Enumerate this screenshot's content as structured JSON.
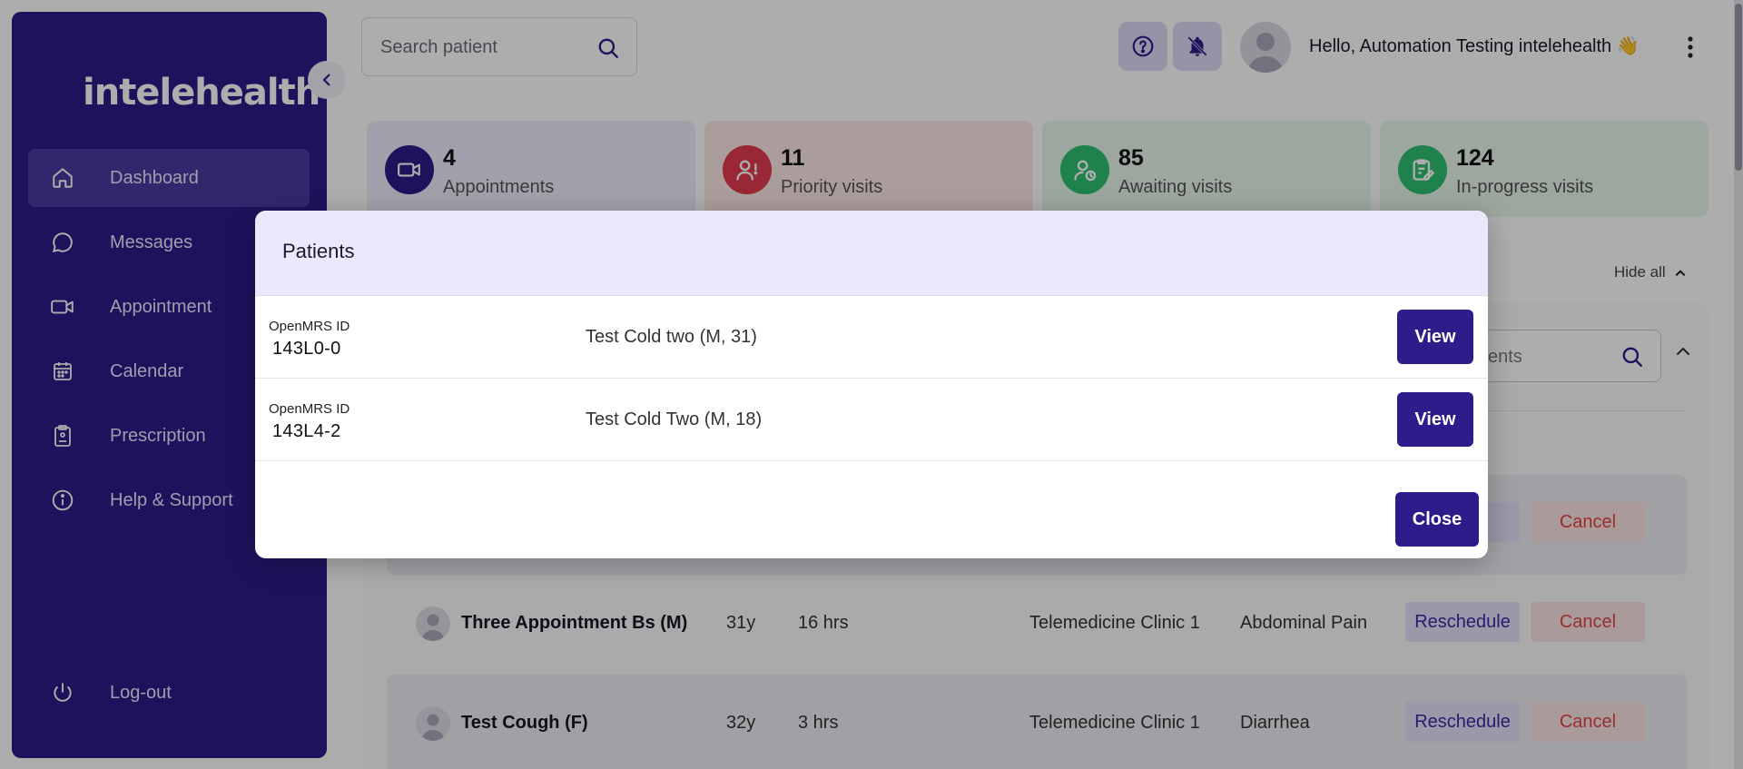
{
  "app": {
    "logo_text": "intelehealth"
  },
  "sidebar": {
    "items": [
      {
        "label": "Dashboard",
        "icon": "home-icon",
        "active": true
      },
      {
        "label": "Messages",
        "icon": "message-icon",
        "active": false
      },
      {
        "label": "Appointment",
        "icon": "video-icon",
        "active": false
      },
      {
        "label": "Calendar",
        "icon": "calendar-icon",
        "active": false
      },
      {
        "label": "Prescription",
        "icon": "prescription-icon",
        "active": false
      },
      {
        "label": "Help & Support",
        "icon": "info-icon",
        "active": false
      }
    ],
    "logout_label": "Log-out"
  },
  "header": {
    "search_placeholder": "Search patient",
    "greeting": "Hello, Automation Testing intelehealth 👋"
  },
  "stats": [
    {
      "value": "4",
      "label": "Appointments",
      "color": "#2f1b8a",
      "bg": "#efedfd"
    },
    {
      "value": "11",
      "label": "Priority visits",
      "color": "#e23a4f",
      "bg": "#fde8e5"
    },
    {
      "value": "85",
      "label": "Awaiting visits",
      "color": "#2fbf71",
      "bg": "#e6f6ec"
    },
    {
      "value": "124",
      "label": "In-progress visits",
      "color": "#2fbf71",
      "bg": "#e6f6ec"
    }
  ],
  "dashboard": {
    "hide_all": "Hide all",
    "appointment_search_placeholder": "ents",
    "rows": [
      {
        "name": "",
        "age": "",
        "duration": "",
        "clinic": "",
        "complaint": "",
        "reschedule": "ule",
        "cancel": "Cancel"
      },
      {
        "name": "Three Appointment Bs (M)",
        "age": "31y",
        "duration": "16 hrs",
        "clinic": "Telemedicine Clinic 1",
        "complaint": "Abdominal Pain",
        "reschedule": "Reschedule",
        "cancel": "Cancel"
      },
      {
        "name": "Test Cough (F)",
        "age": "32y",
        "duration": "3 hrs",
        "clinic": "Telemedicine Clinic 1",
        "complaint": "Diarrhea",
        "reschedule": "Reschedule",
        "cancel": "Cancel"
      }
    ]
  },
  "modal": {
    "title": "Patients",
    "id_label": "OpenMRS ID",
    "patients": [
      {
        "openmrs_id": "143L0-0",
        "name": "Test Cold two (M, 31)",
        "view_label": "View"
      },
      {
        "openmrs_id": "143L4-2",
        "name": "Test Cold Two (M, 18)",
        "view_label": "View"
      }
    ],
    "close_label": "Close"
  },
  "colors": {
    "brand": "#2f1b8a",
    "overlay": "rgba(0,0,0,0.32)"
  }
}
